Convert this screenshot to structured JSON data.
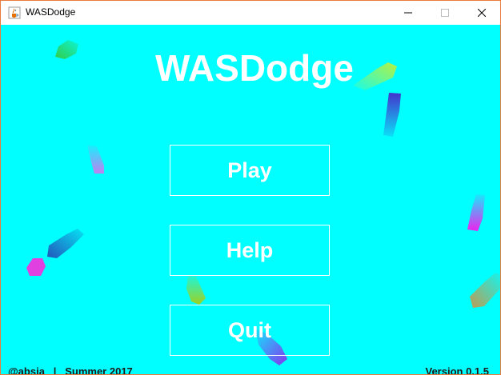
{
  "window": {
    "title": "WASDodge",
    "icon": "java-cup-icon",
    "controls": [
      "minimize-icon",
      "maximize-icon",
      "close-icon"
    ]
  },
  "game": {
    "title": "WASDodge",
    "background_color": "#00ffff",
    "menu": {
      "play_label": "Play",
      "help_label": "Help",
      "quit_label": "Quit"
    },
    "footer": {
      "credit": "@absia   |   Summer 2017",
      "version": "Version 0.1.5"
    }
  },
  "particles": [
    {
      "name": "particle-green",
      "color": "#33cc44"
    },
    {
      "name": "particle-yellowgreen",
      "color": "#b8f040"
    },
    {
      "name": "particle-indigo",
      "color": "#4433cc"
    },
    {
      "name": "particle-violet",
      "color": "#c080f0"
    },
    {
      "name": "particle-magenta",
      "color": "#ee22ee"
    },
    {
      "name": "particle-blue",
      "color": "#2255bb"
    },
    {
      "name": "particle-pink",
      "color": "#e040e0"
    },
    {
      "name": "particle-lime",
      "color": "#a0d020"
    },
    {
      "name": "particle-purple",
      "color": "#8833ee"
    },
    {
      "name": "particle-olive",
      "color": "#c09a50"
    }
  ]
}
